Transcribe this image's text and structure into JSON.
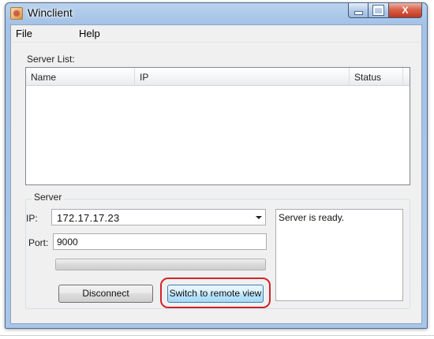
{
  "window": {
    "title": "Winclient",
    "icon": "winclient-app-icon",
    "caption_buttons": [
      "minimize-icon",
      "maximize-icon",
      "close-icon"
    ],
    "close_glyph": "X"
  },
  "menu": {
    "file": "File",
    "help": "Help"
  },
  "server_list": {
    "label": "Server List:",
    "columns": [
      "Name",
      "IP",
      "Status"
    ],
    "rows": []
  },
  "server_group": {
    "label": "Server",
    "ip_label": "IP:",
    "ip_value": "172.17.17.23",
    "port_label": "Port:",
    "port_value": "9000",
    "progress_fraction": 0,
    "status_text": "Server is ready."
  },
  "buttons": {
    "disconnect": "Disconnect",
    "switch_remote": "Switch to remote view"
  },
  "colors": {
    "highlight_ring": "#d2232a"
  }
}
